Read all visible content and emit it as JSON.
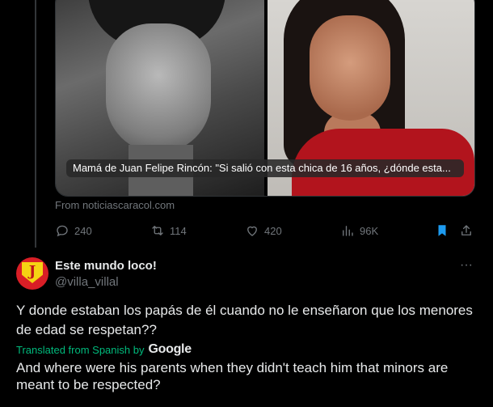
{
  "post": {
    "media": {
      "caption": "Mamá de Juan Felipe Rincón: \"Si salió con esta chica de 16 años, ¿dónde esta...",
      "source": "From noticiascaracol.com"
    },
    "actions": {
      "replies": "240",
      "reposts": "114",
      "likes": "420",
      "views": "96K"
    }
  },
  "reply": {
    "display_name": "Este mundo loco!",
    "handle": "@villa_villal",
    "more_label": "···",
    "avatar_letter": "J",
    "text": "Y donde estaban los papás de él cuando no le enseñaron que los menores de edad se respetan??",
    "translated_label": "Translated from Spanish by",
    "translator": "Google",
    "translation": "And where were his parents when they didn't teach him that minors are meant to be respected?"
  },
  "colors": {
    "background": "#000000",
    "text": "#e7e9ea",
    "muted": "#71767b",
    "accent": "#1d9bf0",
    "translate_green": "#00ba7c"
  }
}
